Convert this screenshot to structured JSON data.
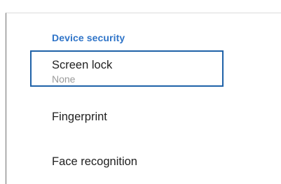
{
  "settings": {
    "section_title": "Device security",
    "items": [
      {
        "title": "Screen lock",
        "summary": "None",
        "focused": true
      },
      {
        "title": "Fingerprint",
        "summary": ""
      },
      {
        "title": "Face recognition",
        "summary": ""
      }
    ]
  },
  "colors": {
    "section_title": "#2f74c8",
    "focus_border": "#1f62a8",
    "summary_text": "#9a9a9a",
    "title_text": "#1f1f1f"
  }
}
